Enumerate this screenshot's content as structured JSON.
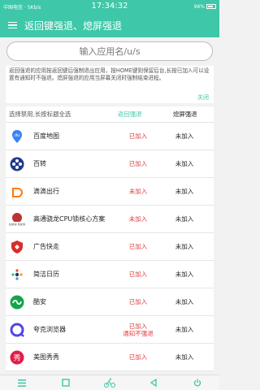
{
  "status_bar": {
    "left": "中国电信 · 5Kb/s",
    "time": "17:34:32",
    "right": "96%"
  },
  "app_bar": {
    "title": "返回键强退、熄屏强退"
  },
  "search": {
    "placeholder": "输入应用名/u/s",
    "value": ""
  },
  "info": {
    "text": "返回强退的应用按返回键后强制退出应用，按HOME键则保留后台,长按已加入可以设置有通知时不强退。熄屏强退的应用当屏幕关闭时强制结束进程。",
    "link": "关闭"
  },
  "list": {
    "header": {
      "title": "选择禁用,长按标题全选",
      "col_back": "返回强退",
      "col_force": "熄屏强退"
    },
    "rows": [
      {
        "name": "百度地图",
        "back": "已加入",
        "force": "未加入",
        "icon": "baidu-map-icon",
        "color": "#3b82f6"
      },
      {
        "name": "百转",
        "back": "已加入",
        "force": "未加入",
        "icon": "film-reel-icon",
        "color": "#1e3a8a"
      },
      {
        "name": "滴滴出行",
        "back": "未加入",
        "force": "未加入",
        "icon": "didi-icon",
        "color": "#ff7a00"
      },
      {
        "name": "高通骁龙CPU锁核心方案",
        "back": "未加入",
        "force": "未加入",
        "icon": "core-lock-icon",
        "color": "#c0392b"
      },
      {
        "name": "广告快走",
        "back": "已加入",
        "force": "未加入",
        "icon": "shield-icon",
        "color": "#d92c2c"
      },
      {
        "name": "简洁日历",
        "back": "已加入",
        "force": "未加入",
        "icon": "calendar-icon",
        "color": "#2d3b55"
      },
      {
        "name": "酷安",
        "back": "已加入",
        "force": "未加入",
        "icon": "coolapk-icon",
        "color": "#16a34a"
      },
      {
        "name": "夸克浏览器",
        "back": "已加入\n通知不强退",
        "force": "未加入",
        "icon": "quark-icon",
        "color": "#4f46e5"
      },
      {
        "name": "美图秀秀",
        "back": "已加入",
        "force": "未加入",
        "icon": "meitu-icon",
        "color": "#e11d48"
      }
    ]
  },
  "nav": {
    "items": [
      "menu-icon",
      "square-icon",
      "cycling-icon",
      "back-icon",
      "power-icon"
    ]
  }
}
